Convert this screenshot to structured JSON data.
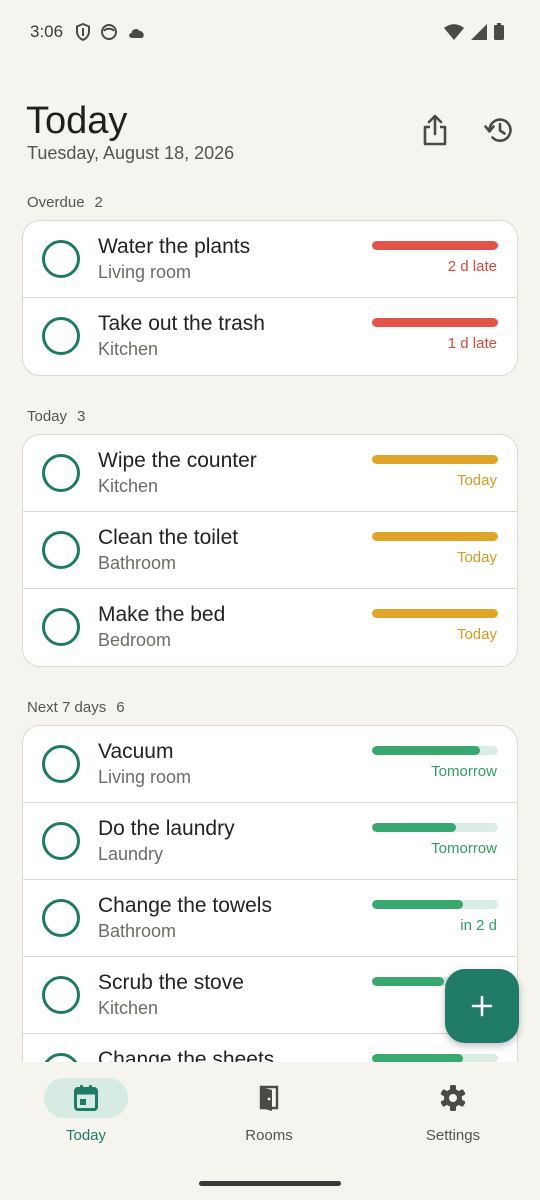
{
  "status_bar": {
    "time": "3:06"
  },
  "header": {
    "title": "Today",
    "date": "Tuesday, August 18, 2026"
  },
  "sections": [
    {
      "title": "Overdue",
      "count": "2",
      "color": "red",
      "tasks": [
        {
          "name": "Water the plants",
          "room": "Living room",
          "due": "2 d late",
          "progress": 1.0
        },
        {
          "name": "Take out the trash",
          "room": "Kitchen",
          "due": "1 d late",
          "progress": 1.0
        }
      ]
    },
    {
      "title": "Today",
      "count": "3",
      "color": "amber",
      "tasks": [
        {
          "name": "Wipe the counter",
          "room": "Kitchen",
          "due": "Today",
          "progress": 1.0
        },
        {
          "name": "Clean the toilet",
          "room": "Bathroom",
          "due": "Today",
          "progress": 1.0
        },
        {
          "name": "Make the bed",
          "room": "Bedroom",
          "due": "Today",
          "progress": 1.0
        }
      ]
    },
    {
      "title": "Next 7 days",
      "count": "6",
      "color": "green",
      "tasks": [
        {
          "name": "Vacuum",
          "room": "Living room",
          "due": "Tomorrow",
          "progress": 0.86
        },
        {
          "name": "Do the laundry",
          "room": "Laundry",
          "due": "Tomorrow",
          "progress": 0.67
        },
        {
          "name": "Change the towels",
          "room": "Bathroom",
          "due": "in 2 d",
          "progress": 0.72
        },
        {
          "name": "Scrub the stove",
          "room": "Kitchen",
          "due": "",
          "progress": 0.57
        },
        {
          "name": "Change the sheets",
          "room": "",
          "due": "",
          "progress": 0.72
        }
      ]
    }
  ],
  "nav": [
    {
      "label": "Today",
      "icon": "calendar-icon",
      "active": true
    },
    {
      "label": "Rooms",
      "icon": "door-icon",
      "active": false
    },
    {
      "label": "Settings",
      "icon": "gear-icon",
      "active": false
    }
  ],
  "colors": {
    "accent": "#1f7a66",
    "overdue": "#e0544a",
    "today": "#e0a528",
    "upcoming": "#38a86f"
  }
}
